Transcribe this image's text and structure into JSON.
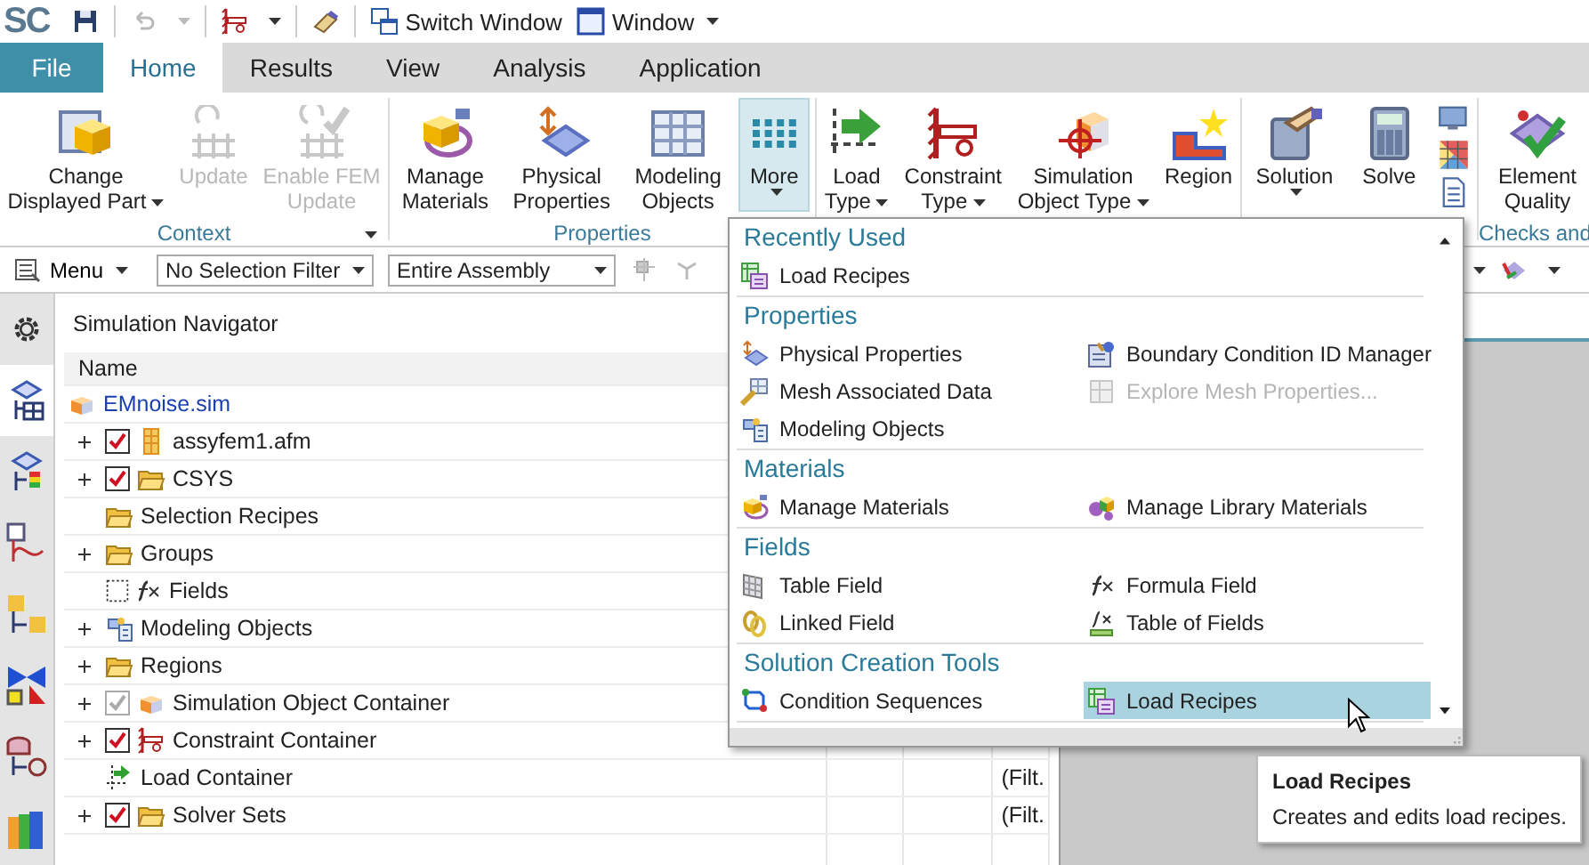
{
  "quick_access": {
    "logo": "SC",
    "items": [
      {
        "label": "Switch Window",
        "caret": false
      },
      {
        "label": "Window",
        "caret": true
      }
    ]
  },
  "tabs": [
    {
      "label": "File",
      "kind": "file",
      "selected": false
    },
    {
      "label": "Home",
      "kind": "tab",
      "selected": true
    },
    {
      "label": "Results",
      "kind": "tab",
      "selected": false
    },
    {
      "label": "View",
      "kind": "tab",
      "selected": false
    },
    {
      "label": "Analysis",
      "kind": "tab",
      "selected": false
    },
    {
      "label": "Application",
      "kind": "tab",
      "selected": false
    }
  ],
  "ribbon": {
    "groups": [
      {
        "label": "Context",
        "launcher": true,
        "buttons": [
          {
            "label": "Change\nDisplayed Part",
            "kind": "dropdown",
            "disabled": false,
            "active": false
          },
          {
            "label": "Update",
            "kind": "plain",
            "disabled": true,
            "active": false
          },
          {
            "label": "Enable FEM\nUpdate",
            "kind": "plain",
            "disabled": true,
            "active": false
          }
        ]
      },
      {
        "label": "Properties",
        "buttons": [
          {
            "label": "Manage\nMaterials",
            "kind": "plain",
            "disabled": false,
            "active": false
          },
          {
            "label": "Physical\nProperties",
            "kind": "plain",
            "disabled": false,
            "active": false
          },
          {
            "label": "Modeling\nObjects",
            "kind": "plain",
            "disabled": false,
            "active": false
          },
          {
            "label": "More",
            "kind": "split",
            "disabled": false,
            "active": true
          }
        ]
      },
      {
        "buttons": [
          {
            "label": "Load\nType",
            "kind": "dropdown",
            "disabled": false,
            "active": false
          },
          {
            "label": "Constraint\nType",
            "kind": "dropdown",
            "disabled": false,
            "active": false
          },
          {
            "label": "Simulation\nObject Type",
            "kind": "dropdown",
            "disabled": false,
            "active": false
          },
          {
            "label": "Region",
            "kind": "plain",
            "disabled": false,
            "active": false
          }
        ]
      },
      {
        "buttons": [
          {
            "label": "Solution",
            "kind": "split",
            "disabled": false,
            "active": false
          },
          {
            "label": "Solve",
            "kind": "plain",
            "disabled": false,
            "active": false
          }
        ]
      },
      {
        "label": "Checks and",
        "buttons": [
          {
            "label": "Element\nQuality",
            "kind": "plain",
            "disabled": false,
            "active": false
          }
        ]
      }
    ]
  },
  "command_bar": {
    "menu": "Menu",
    "filters": [
      {
        "value": "No Selection Filter"
      },
      {
        "value": "Entire Assembly"
      }
    ]
  },
  "resource_tabs": [
    {
      "selected": true
    },
    {
      "selected": false
    },
    {
      "selected": false
    },
    {
      "selected": false
    },
    {
      "selected": false
    },
    {
      "selected": false
    },
    {
      "selected": false
    }
  ],
  "navigator": {
    "title": "Simulation Navigator",
    "columns": [
      "Name"
    ],
    "tree": {
      "label": "EMnoise.sim",
      "children": [
        {
          "label": "assyfem1.afm",
          "expandable": true,
          "kind": "checkbox",
          "checked": true,
          "disabled": false
        },
        {
          "label": "CSYS",
          "expandable": true,
          "kind": "checkbox",
          "checked": true,
          "disabled": false
        },
        {
          "label": "Selection Recipes",
          "expandable": false,
          "kind": "plain"
        },
        {
          "label": "Groups",
          "expandable": true,
          "kind": "plain"
        },
        {
          "label": "Fields",
          "expandable": false,
          "kind": "placeholder"
        },
        {
          "label": "Modeling Objects",
          "expandable": true,
          "kind": "plain"
        },
        {
          "label": "Regions",
          "expandable": true,
          "kind": "plain"
        },
        {
          "label": "Simulation Object Container",
          "expandable": true,
          "kind": "checkbox",
          "checked": true,
          "disabled": true
        },
        {
          "label": "Constraint Container",
          "expandable": true,
          "kind": "checkbox",
          "checked": true,
          "disabled": false
        },
        {
          "label": "Load Container",
          "expandable": false,
          "kind": "plain",
          "column_4": "(Filt."
        },
        {
          "label": "Solver Sets",
          "expandable": true,
          "kind": "checkbox",
          "checked": true,
          "disabled": false,
          "column_4": "(Filt."
        }
      ]
    }
  },
  "more_menu": {
    "sections": [
      {
        "title": "Recently Used",
        "items": [
          {
            "label": "Load Recipes",
            "disabled": false,
            "selected": false
          }
        ]
      },
      {
        "title": "Properties",
        "items": [
          {
            "label": "Physical Properties",
            "disabled": false,
            "selected": false
          },
          {
            "label": "Boundary Condition ID Manager",
            "disabled": false,
            "selected": false
          },
          {
            "label": "Mesh Associated Data",
            "disabled": false,
            "selected": false
          },
          {
            "label": "Explore Mesh Properties...",
            "disabled": true,
            "selected": false
          },
          {
            "label": "Modeling Objects",
            "disabled": false,
            "selected": false
          }
        ]
      },
      {
        "title": "Materials",
        "items": [
          {
            "label": "Manage Materials",
            "disabled": false,
            "selected": false
          },
          {
            "label": "Manage Library Materials",
            "disabled": false,
            "selected": false
          }
        ]
      },
      {
        "title": "Fields",
        "items": [
          {
            "label": "Table Field",
            "disabled": false,
            "selected": false
          },
          {
            "label": "Formula Field",
            "disabled": false,
            "selected": false
          },
          {
            "label": "Linked Field",
            "disabled": false,
            "selected": false
          },
          {
            "label": "Table of Fields",
            "disabled": false,
            "selected": false
          }
        ]
      },
      {
        "title": "Solution Creation Tools",
        "items": [
          {
            "label": "Condition Sequences",
            "disabled": false,
            "selected": false
          },
          {
            "label": "Load Recipes",
            "disabled": false,
            "selected": true
          }
        ]
      }
    ]
  },
  "tooltip": {
    "title": "Load Recipes",
    "text": "Creates and edits load recipes."
  }
}
